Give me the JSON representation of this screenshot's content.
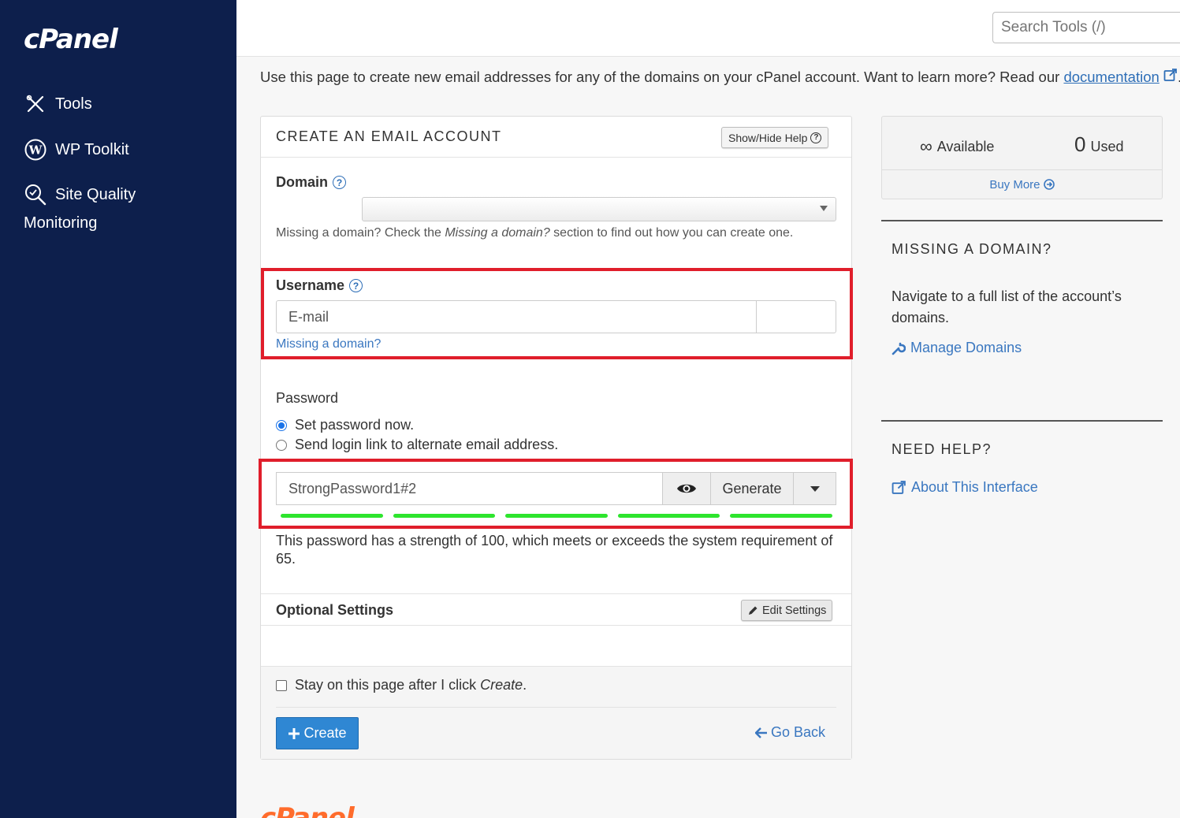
{
  "sidebar": {
    "logo": "cPanel",
    "items": [
      {
        "label": "Tools"
      },
      {
        "label": "WP Toolkit"
      },
      {
        "label": "Site Quality"
      },
      {
        "label": "Monitoring"
      }
    ]
  },
  "header": {
    "search_placeholder": "Search Tools (/)"
  },
  "intro": {
    "text": "Use this page to create new email addresses for any of the domains on your cPanel account. Want to learn more? Read our ",
    "link": "documentation",
    "end": "."
  },
  "form": {
    "title": "CREATE AN EMAIL ACCOUNT",
    "help_button": "Show/Hide Help",
    "domain_label": "Domain",
    "domain_hint_pre": "Missing a domain? Check the ",
    "domain_hint_em": "Missing a domain?",
    "domain_hint_post": " section to find out how you can create one.",
    "username_label": "Username",
    "username_placeholder": "E-mail",
    "missing_domain_link": "Missing a domain?",
    "password_label": "Password",
    "radio_set_now": "Set password now.",
    "radio_send_link": "Send login link to alternate email address.",
    "password_value": "StrongPassword1#2",
    "generate_label": "Generate",
    "strength_bars": 5,
    "strength_text": "This password has a strength of 100, which meets or exceeds the system requirement of 65.",
    "optional_title": "Optional Settings",
    "edit_settings": "Edit Settings",
    "stay_pre": "Stay on this page after I click ",
    "stay_em": "Create",
    "stay_post": ".",
    "create_label": "Create",
    "go_back": "Go Back"
  },
  "stats": {
    "available_symbol": "∞",
    "available_label": "Available",
    "used_count": "0",
    "used_label": "Used",
    "buy_more": "Buy More"
  },
  "missing_domain": {
    "title": "MISSING A DOMAIN?",
    "text": "Navigate to a full list of the account’s domains.",
    "link": "Manage Domains"
  },
  "need_help": {
    "title": "NEED HELP?",
    "link": "About This Interface"
  },
  "footer": {
    "logo": "cPanel"
  },
  "colors": {
    "sidebar_bg": "#0d1f4c",
    "accent": "#2f87d3",
    "highlight_box": "#e01e2b",
    "strength": "#2ee52e",
    "footer_logo": "#ff6c2c"
  }
}
